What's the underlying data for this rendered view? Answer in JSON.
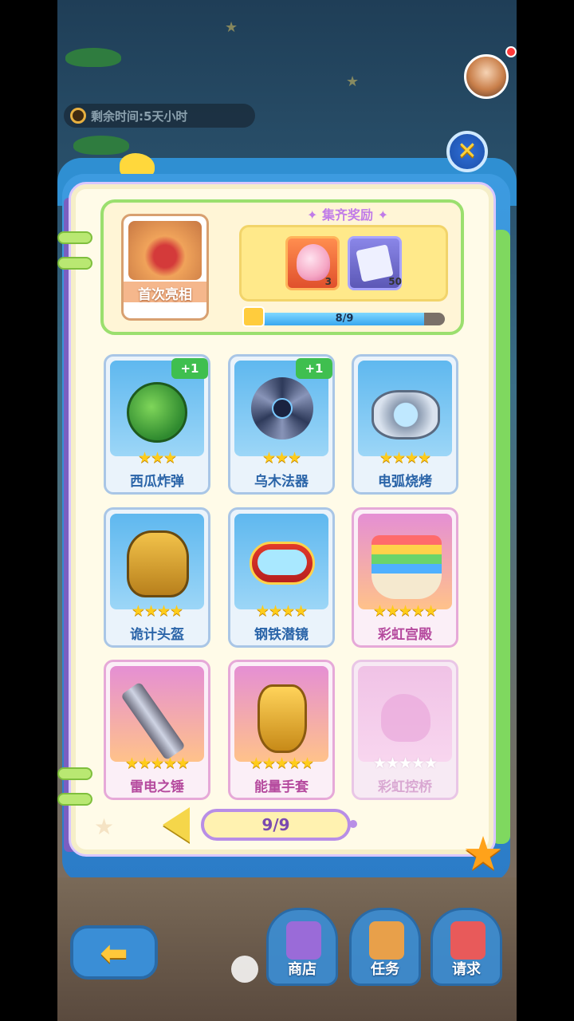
{
  "timer": {
    "label": "剩余时间:",
    "value": "5天小时"
  },
  "reward": {
    "title": "集齐奖励",
    "first_card_label": "首次亮相",
    "items": [
      {
        "icon": "conch-shell-icon",
        "qty": "3"
      },
      {
        "icon": "ticket-icon",
        "qty": "50"
      }
    ],
    "progress_text": "8/9",
    "progress_fraction": 0.889
  },
  "cards": [
    {
      "name": "西瓜炸弹",
      "stars": "★★★",
      "badge": "+1",
      "theme": "blue",
      "icon": "watermelon-bomb-icon"
    },
    {
      "name": "乌木法器",
      "stars": "★★★",
      "badge": "+1",
      "theme": "blue",
      "icon": "ebony-blade-icon"
    },
    {
      "name": "电弧烧烤",
      "stars": "★★★★",
      "badge": "",
      "theme": "blue",
      "icon": "arc-grill-icon"
    },
    {
      "name": "诡计头盔",
      "stars": "★★★★",
      "badge": "",
      "theme": "blue",
      "icon": "trickster-helmet-icon"
    },
    {
      "name": "钢铁潜镜",
      "stars": "★★★★",
      "badge": "",
      "theme": "blue",
      "icon": "iron-goggles-icon"
    },
    {
      "name": "彩虹宫殿",
      "stars": "★★★★★",
      "badge": "",
      "theme": "pink",
      "icon": "rainbow-palace-icon"
    },
    {
      "name": "雷电之锤",
      "stars": "★★★★★",
      "badge": "",
      "theme": "pink",
      "icon": "thunder-axe-icon"
    },
    {
      "name": "能量手套",
      "stars": "★★★★★",
      "badge": "",
      "theme": "pink",
      "icon": "power-gauntlet-icon"
    },
    {
      "name": "彩虹控桥",
      "stars": "★★★★★",
      "badge": "",
      "theme": "locked",
      "icon": "duck-silhouette-icon"
    }
  ],
  "pager": {
    "text": "9/9"
  },
  "nav": {
    "shop": "商店",
    "quest": "任务",
    "request": "请求"
  },
  "close_symbol": "✕",
  "back_symbol": "⬅",
  "colors": {
    "panel": "#fffbe8",
    "accent_green": "#3fbf4f",
    "star": "#ffcc1a",
    "pager_border": "#b88ee6"
  }
}
